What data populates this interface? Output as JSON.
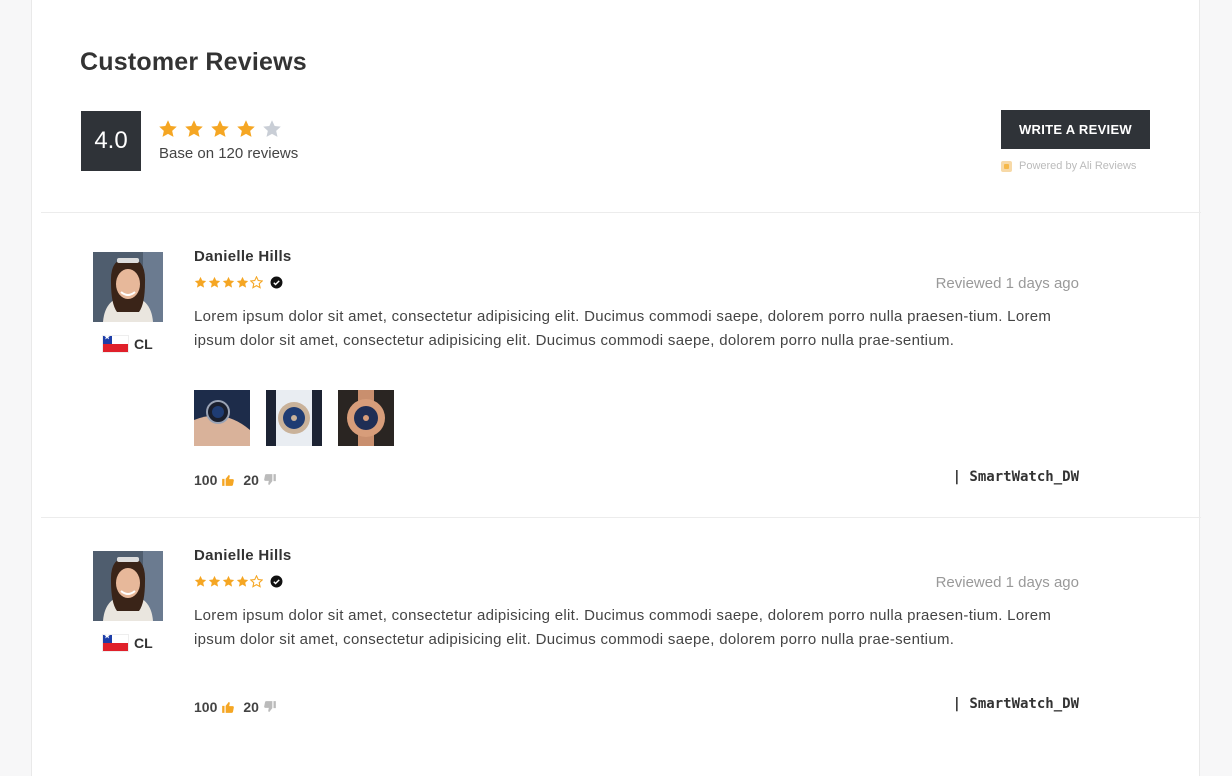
{
  "title": "Customer Reviews",
  "summary": {
    "score": "4.0",
    "rating": 4,
    "max_rating": 5,
    "text": "Base on 120 reviews",
    "write_button": "WRITE A REVIEW",
    "powered_by": "Powered by Ali Reviews"
  },
  "colors": {
    "star": "#f5a623",
    "star_empty": "#c9ced6",
    "dark": "#2f3338"
  },
  "reviews": [
    {
      "name": "Danielle Hills",
      "country": "CL",
      "rating": 4,
      "verified_icon": "verified-check-icon",
      "date": "Reviewed 1 days ago",
      "text": "Lorem ipsum dolor sit amet, consectetur adipisicing elit. Ducimus commodi saepe, dolorem porro nulla praesen-tium. Lorem ipsum dolor sit amet, consectetur adipisicing elit. Ducimus commodi saepe, dolorem porro nulla prae-sentium.",
      "photos": [
        "watch-photo-1",
        "watch-photo-2",
        "watch-photo-3"
      ],
      "likes": "100",
      "dislikes": "20",
      "product": "| SmartWatch_DW"
    },
    {
      "name": "Danielle Hills",
      "country": "CL",
      "rating": 4,
      "verified_icon": "verified-check-icon",
      "date": "Reviewed 1 days ago",
      "text": "Lorem ipsum dolor sit amet, consectetur adipisicing elit. Ducimus commodi saepe, dolorem porro nulla praesen-tium. Lorem ipsum dolor sit amet, consectetur adipisicing elit. Ducimus commodi saepe, dolorem porro nulla prae-sentium.",
      "photos": [],
      "likes": "100",
      "dislikes": "20",
      "product": "| SmartWatch_DW"
    }
  ]
}
